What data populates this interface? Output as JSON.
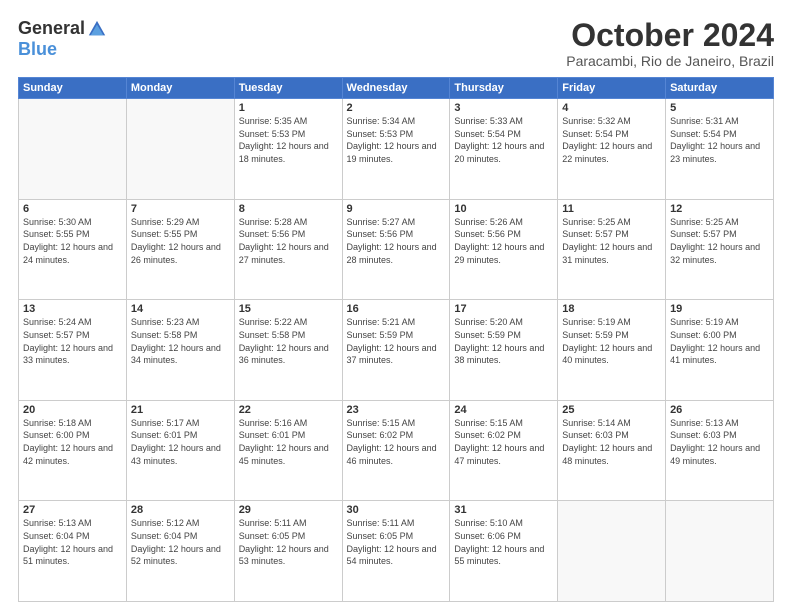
{
  "logo": {
    "general": "General",
    "blue": "Blue"
  },
  "title": "October 2024",
  "location": "Paracambi, Rio de Janeiro, Brazil",
  "days_of_week": [
    "Sunday",
    "Monday",
    "Tuesday",
    "Wednesday",
    "Thursday",
    "Friday",
    "Saturday"
  ],
  "weeks": [
    [
      {
        "day": "",
        "sunrise": "",
        "sunset": "",
        "daylight": ""
      },
      {
        "day": "",
        "sunrise": "",
        "sunset": "",
        "daylight": ""
      },
      {
        "day": "1",
        "sunrise": "Sunrise: 5:35 AM",
        "sunset": "Sunset: 5:53 PM",
        "daylight": "Daylight: 12 hours and 18 minutes."
      },
      {
        "day": "2",
        "sunrise": "Sunrise: 5:34 AM",
        "sunset": "Sunset: 5:53 PM",
        "daylight": "Daylight: 12 hours and 19 minutes."
      },
      {
        "day": "3",
        "sunrise": "Sunrise: 5:33 AM",
        "sunset": "Sunset: 5:54 PM",
        "daylight": "Daylight: 12 hours and 20 minutes."
      },
      {
        "day": "4",
        "sunrise": "Sunrise: 5:32 AM",
        "sunset": "Sunset: 5:54 PM",
        "daylight": "Daylight: 12 hours and 22 minutes."
      },
      {
        "day": "5",
        "sunrise": "Sunrise: 5:31 AM",
        "sunset": "Sunset: 5:54 PM",
        "daylight": "Daylight: 12 hours and 23 minutes."
      }
    ],
    [
      {
        "day": "6",
        "sunrise": "Sunrise: 5:30 AM",
        "sunset": "Sunset: 5:55 PM",
        "daylight": "Daylight: 12 hours and 24 minutes."
      },
      {
        "day": "7",
        "sunrise": "Sunrise: 5:29 AM",
        "sunset": "Sunset: 5:55 PM",
        "daylight": "Daylight: 12 hours and 26 minutes."
      },
      {
        "day": "8",
        "sunrise": "Sunrise: 5:28 AM",
        "sunset": "Sunset: 5:56 PM",
        "daylight": "Daylight: 12 hours and 27 minutes."
      },
      {
        "day": "9",
        "sunrise": "Sunrise: 5:27 AM",
        "sunset": "Sunset: 5:56 PM",
        "daylight": "Daylight: 12 hours and 28 minutes."
      },
      {
        "day": "10",
        "sunrise": "Sunrise: 5:26 AM",
        "sunset": "Sunset: 5:56 PM",
        "daylight": "Daylight: 12 hours and 29 minutes."
      },
      {
        "day": "11",
        "sunrise": "Sunrise: 5:25 AM",
        "sunset": "Sunset: 5:57 PM",
        "daylight": "Daylight: 12 hours and 31 minutes."
      },
      {
        "day": "12",
        "sunrise": "Sunrise: 5:25 AM",
        "sunset": "Sunset: 5:57 PM",
        "daylight": "Daylight: 12 hours and 32 minutes."
      }
    ],
    [
      {
        "day": "13",
        "sunrise": "Sunrise: 5:24 AM",
        "sunset": "Sunset: 5:57 PM",
        "daylight": "Daylight: 12 hours and 33 minutes."
      },
      {
        "day": "14",
        "sunrise": "Sunrise: 5:23 AM",
        "sunset": "Sunset: 5:58 PM",
        "daylight": "Daylight: 12 hours and 34 minutes."
      },
      {
        "day": "15",
        "sunrise": "Sunrise: 5:22 AM",
        "sunset": "Sunset: 5:58 PM",
        "daylight": "Daylight: 12 hours and 36 minutes."
      },
      {
        "day": "16",
        "sunrise": "Sunrise: 5:21 AM",
        "sunset": "Sunset: 5:59 PM",
        "daylight": "Daylight: 12 hours and 37 minutes."
      },
      {
        "day": "17",
        "sunrise": "Sunrise: 5:20 AM",
        "sunset": "Sunset: 5:59 PM",
        "daylight": "Daylight: 12 hours and 38 minutes."
      },
      {
        "day": "18",
        "sunrise": "Sunrise: 5:19 AM",
        "sunset": "Sunset: 5:59 PM",
        "daylight": "Daylight: 12 hours and 40 minutes."
      },
      {
        "day": "19",
        "sunrise": "Sunrise: 5:19 AM",
        "sunset": "Sunset: 6:00 PM",
        "daylight": "Daylight: 12 hours and 41 minutes."
      }
    ],
    [
      {
        "day": "20",
        "sunrise": "Sunrise: 5:18 AM",
        "sunset": "Sunset: 6:00 PM",
        "daylight": "Daylight: 12 hours and 42 minutes."
      },
      {
        "day": "21",
        "sunrise": "Sunrise: 5:17 AM",
        "sunset": "Sunset: 6:01 PM",
        "daylight": "Daylight: 12 hours and 43 minutes."
      },
      {
        "day": "22",
        "sunrise": "Sunrise: 5:16 AM",
        "sunset": "Sunset: 6:01 PM",
        "daylight": "Daylight: 12 hours and 45 minutes."
      },
      {
        "day": "23",
        "sunrise": "Sunrise: 5:15 AM",
        "sunset": "Sunset: 6:02 PM",
        "daylight": "Daylight: 12 hours and 46 minutes."
      },
      {
        "day": "24",
        "sunrise": "Sunrise: 5:15 AM",
        "sunset": "Sunset: 6:02 PM",
        "daylight": "Daylight: 12 hours and 47 minutes."
      },
      {
        "day": "25",
        "sunrise": "Sunrise: 5:14 AM",
        "sunset": "Sunset: 6:03 PM",
        "daylight": "Daylight: 12 hours and 48 minutes."
      },
      {
        "day": "26",
        "sunrise": "Sunrise: 5:13 AM",
        "sunset": "Sunset: 6:03 PM",
        "daylight": "Daylight: 12 hours and 49 minutes."
      }
    ],
    [
      {
        "day": "27",
        "sunrise": "Sunrise: 5:13 AM",
        "sunset": "Sunset: 6:04 PM",
        "daylight": "Daylight: 12 hours and 51 minutes."
      },
      {
        "day": "28",
        "sunrise": "Sunrise: 5:12 AM",
        "sunset": "Sunset: 6:04 PM",
        "daylight": "Daylight: 12 hours and 52 minutes."
      },
      {
        "day": "29",
        "sunrise": "Sunrise: 5:11 AM",
        "sunset": "Sunset: 6:05 PM",
        "daylight": "Daylight: 12 hours and 53 minutes."
      },
      {
        "day": "30",
        "sunrise": "Sunrise: 5:11 AM",
        "sunset": "Sunset: 6:05 PM",
        "daylight": "Daylight: 12 hours and 54 minutes."
      },
      {
        "day": "31",
        "sunrise": "Sunrise: 5:10 AM",
        "sunset": "Sunset: 6:06 PM",
        "daylight": "Daylight: 12 hours and 55 minutes."
      },
      {
        "day": "",
        "sunrise": "",
        "sunset": "",
        "daylight": ""
      },
      {
        "day": "",
        "sunrise": "",
        "sunset": "",
        "daylight": ""
      }
    ]
  ]
}
